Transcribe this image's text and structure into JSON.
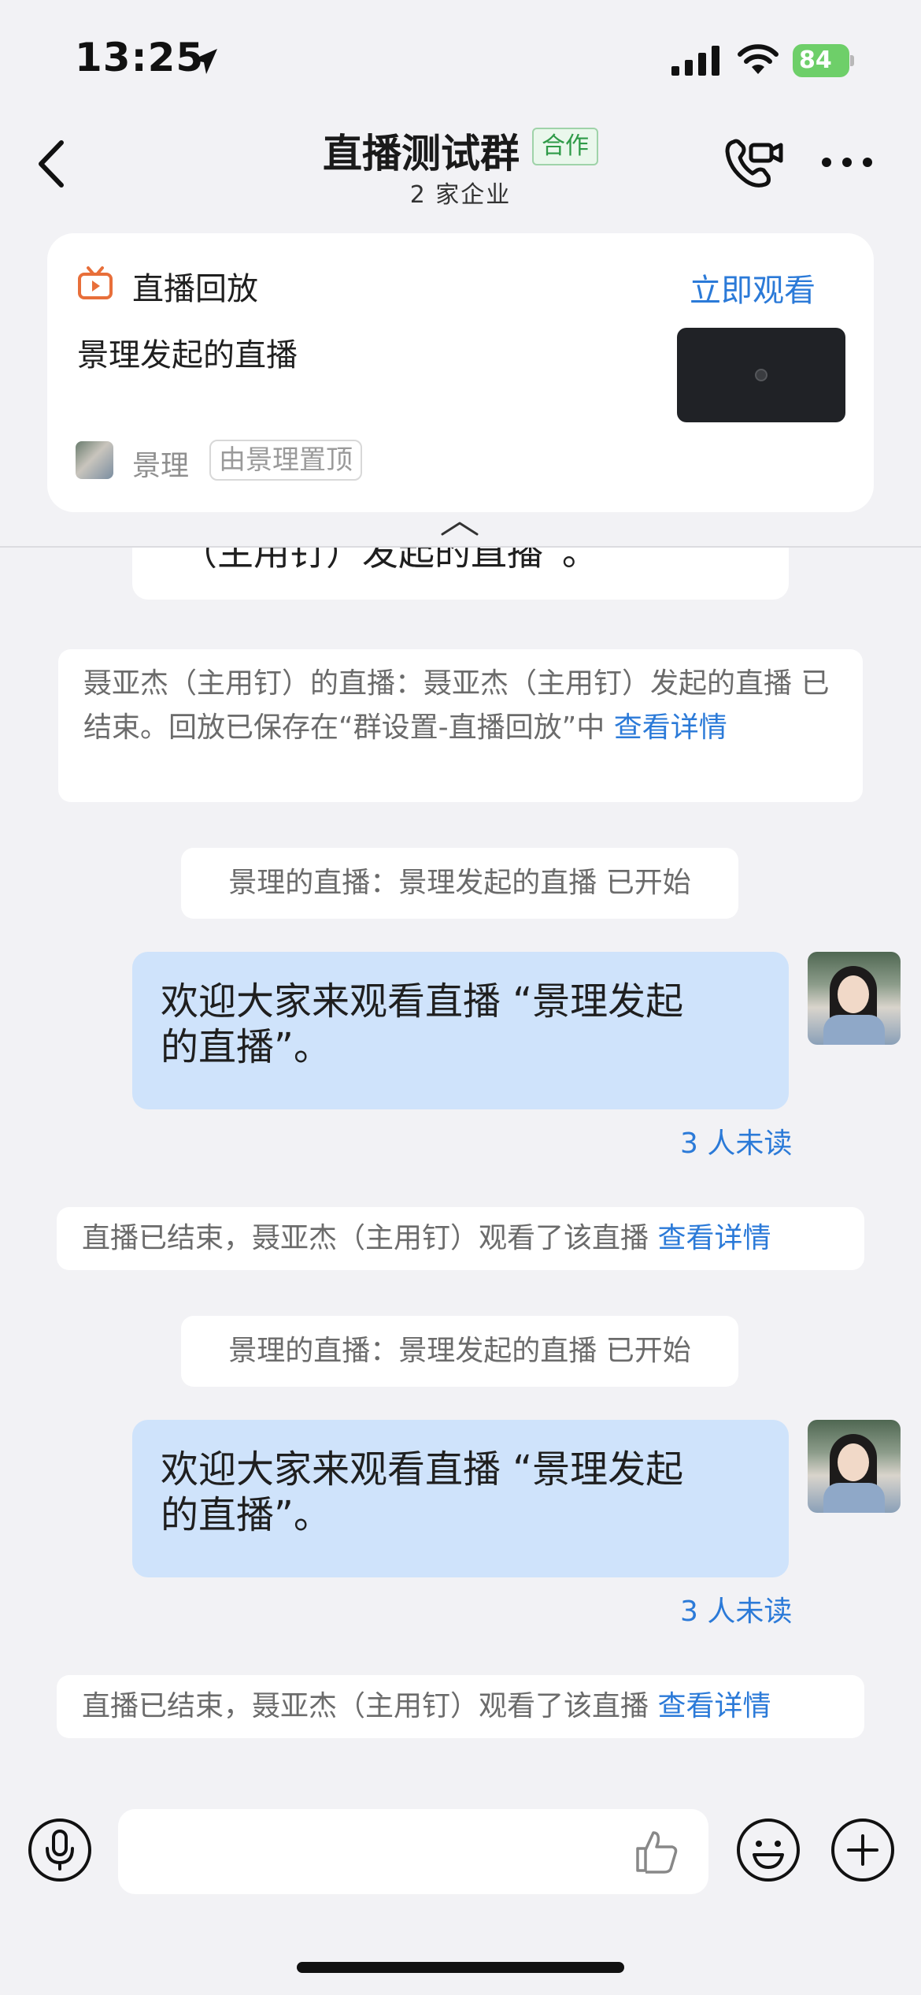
{
  "status_bar": {
    "time": "13:25",
    "battery": "84"
  },
  "nav": {
    "title": "直播测试群",
    "tag": "合作",
    "subtitle": "2 家企业"
  },
  "pinned": {
    "label": "直播回放",
    "action": "立即观看",
    "title": "景理发起的直播",
    "user": "景理",
    "pinned_by": "由景理置顶"
  },
  "messages": {
    "partial_text": "（主用钉）发起的直播”。",
    "sys1": {
      "text": "聂亚杰（主用钉）的直播：聂亚杰（主用钉）发起的直播 已结束。回放已保存在“群设置-直播回放”中 ",
      "link": "查看详情"
    },
    "sys2": {
      "text": "景理的直播：景理发起的直播 已开始"
    },
    "bubble1": {
      "line1": "欢迎大家来观看直播 “景理发起",
      "line2": "的直播”。",
      "unread": "3 人未读"
    },
    "sys3": {
      "text": "直播已结束，聂亚杰（主用钉）观看了该直播 ",
      "link": "查看详情"
    },
    "sys4": {
      "text": "景理的直播：景理发起的直播 已开始"
    },
    "bubble2": {
      "line1": "欢迎大家来观看直播 “景理发起",
      "line2": "的直播”。",
      "unread": "3 人未读"
    },
    "sys5": {
      "text": "直播已结束，聂亚杰（主用钉）观看了该直播 ",
      "link": "查看详情"
    }
  },
  "colors": {
    "accent": "#2b7ad8",
    "bubble": "#cfe3fb",
    "coop_tag": "#2e9a47",
    "tv_icon": "#e86f3a"
  }
}
